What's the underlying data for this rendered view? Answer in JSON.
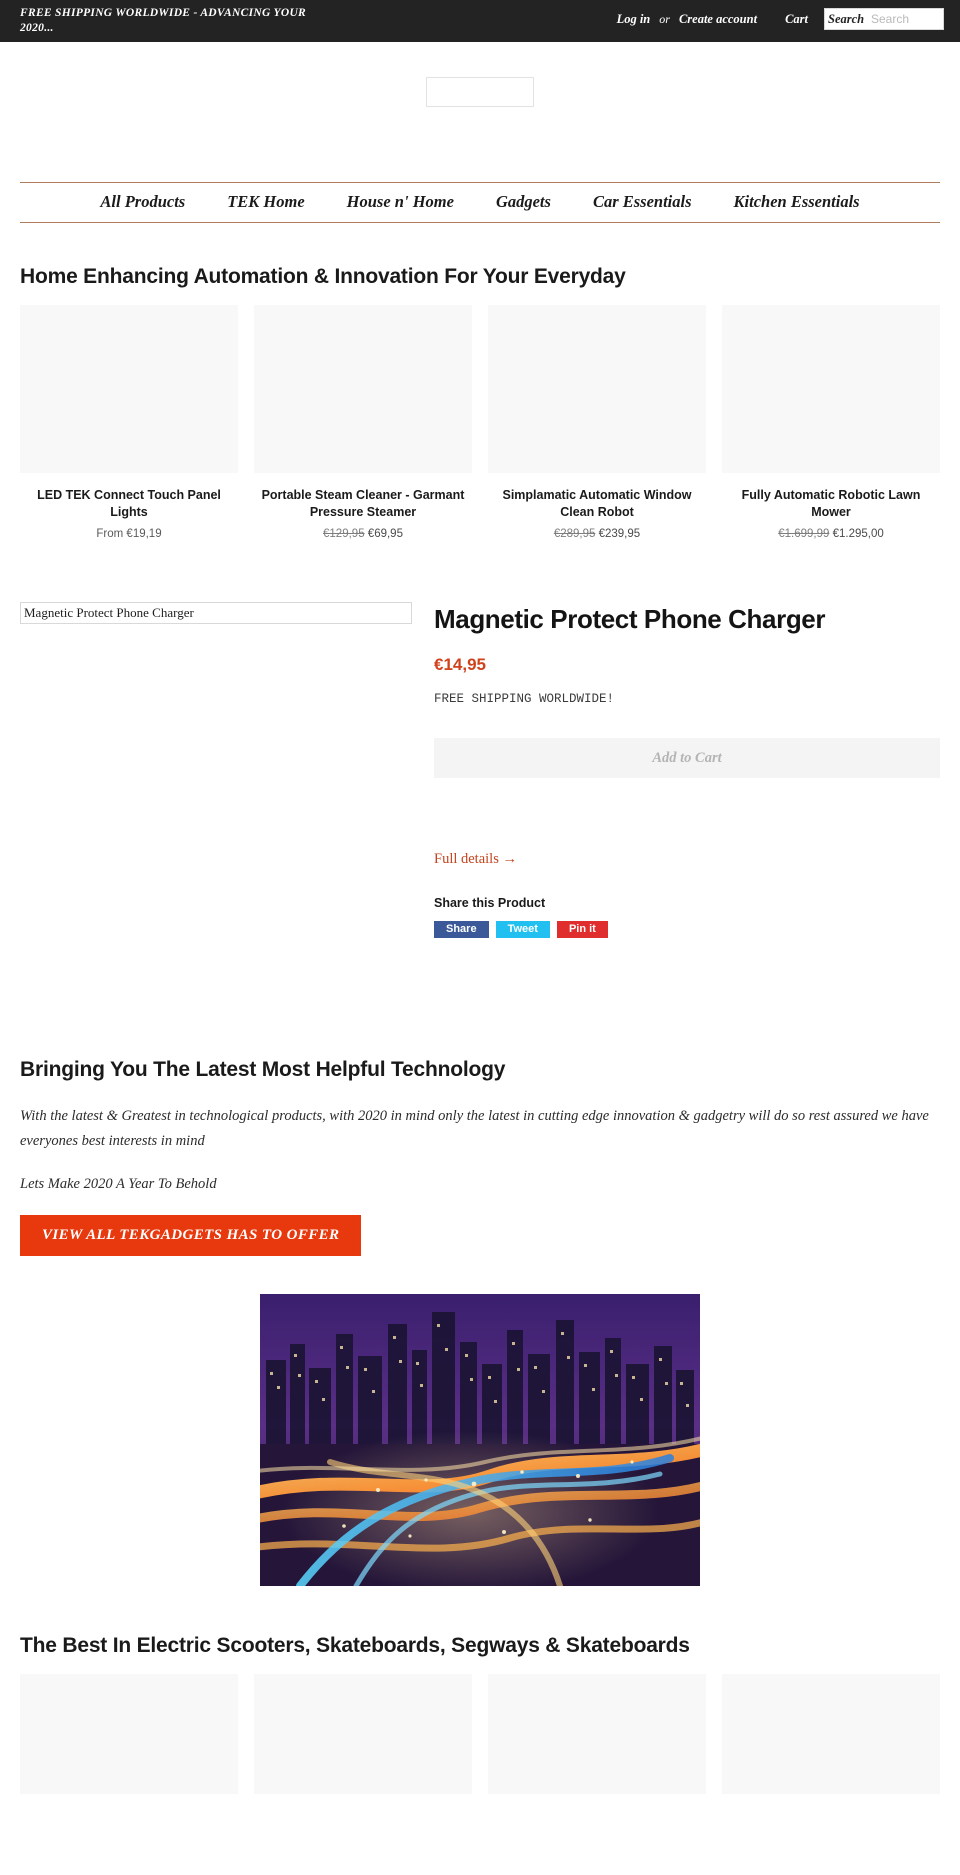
{
  "topbar": {
    "message": "FREE SHIPPING WORLDWIDE - ADVANCING YOUR 2020...",
    "login_label": "Log in",
    "or_label": "or",
    "create_account_label": "Create account",
    "cart_label": "Cart",
    "search_label": "Search",
    "search_placeholder": "Search",
    "search_value": "",
    "background_color": "#232323"
  },
  "nav": {
    "items": [
      {
        "label": "All Products"
      },
      {
        "label": "TEK Home"
      },
      {
        "label": "House n' Home"
      },
      {
        "label": "Gadgets"
      },
      {
        "label": "Car Essentials"
      },
      {
        "label": "Kitchen Essentials"
      }
    ],
    "border_color": "#b07a5c"
  },
  "collection": {
    "title": "Home Enhancing Automation & Innovation For Your Everyday",
    "products": [
      {
        "title": "LED TEK Connect Touch Panel Lights",
        "price_prefix": "From ",
        "price": "€19,19",
        "price_old": "",
        "price_new": ""
      },
      {
        "title": "Portable Steam Cleaner - Garmant Pressure Steamer",
        "price_prefix": "",
        "price": "",
        "price_old": "€129,95",
        "price_new": "€69,95"
      },
      {
        "title": "Simplamatic Automatic Window Clean Robot",
        "price_prefix": "",
        "price": "",
        "price_old": "€289,95",
        "price_new": "€239,95"
      },
      {
        "title": "Fully Automatic Robotic Lawn Mower",
        "price_prefix": "",
        "price": "",
        "price_old": "€1.699,99",
        "price_new": "€1.295,00"
      }
    ]
  },
  "featured": {
    "image_alt": "Magnetic Protect Phone Charger",
    "title": "Magnetic Protect Phone Charger",
    "price": "€14,95",
    "price_color": "#d0421b",
    "shipping_note": "FREE SHIPPING WORLDWIDE!",
    "add_to_cart_label": "Add to Cart",
    "full_details_label": "Full details →",
    "share_title": "Share this Product",
    "share_buttons": [
      {
        "label": "Share",
        "color": "#3b5998"
      },
      {
        "label": "Tweet",
        "color": "#22c0f0"
      },
      {
        "label": "Pin it",
        "color": "#e02d2d"
      }
    ]
  },
  "marketing": {
    "title": "Bringing You The Latest Most Helpful Technology",
    "body": "With the latest & Greatest in technological products, with 2020 in mind only the latest in cutting edge innovation & gadgetry will do so rest assured we have everyones best interests in mind",
    "tagline": "Lets Make 2020 A Year To Behold",
    "cta_label": "VIEW ALL TEKGADGETS HAS TO OFFER",
    "cta_color": "#e8380d"
  },
  "hero": {
    "alt": "City highway interchange at night with light trails"
  },
  "bottom_collection": {
    "title": "The Best In Electric Scooters, Skateboards, Segways & Skateboards",
    "cells": [
      {},
      {},
      {},
      {}
    ]
  }
}
